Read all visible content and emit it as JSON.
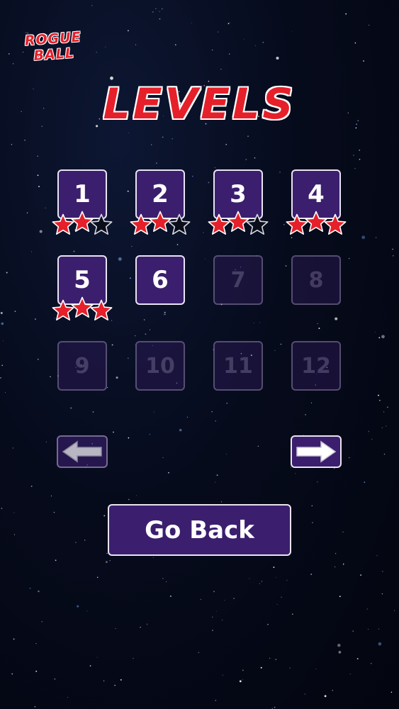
{
  "app": {
    "logo_line1": "ROGUE",
    "logo_line2": "BALL"
  },
  "screen": {
    "title": "LEVELS"
  },
  "levels": [
    {
      "label": "1",
      "unlocked": true,
      "stars": 2
    },
    {
      "label": "2",
      "unlocked": true,
      "stars": 2
    },
    {
      "label": "3",
      "unlocked": true,
      "stars": 2
    },
    {
      "label": "4",
      "unlocked": true,
      "stars": 3
    },
    {
      "label": "5",
      "unlocked": true,
      "stars": 3
    },
    {
      "label": "6",
      "unlocked": true,
      "stars": 0
    },
    {
      "label": "7",
      "unlocked": false,
      "stars": 0
    },
    {
      "label": "8",
      "unlocked": false,
      "stars": 0
    },
    {
      "label": "9",
      "unlocked": false,
      "stars": 0
    },
    {
      "label": "10",
      "unlocked": false,
      "stars": 0
    },
    {
      "label": "11",
      "unlocked": false,
      "stars": 0
    },
    {
      "label": "12",
      "unlocked": false,
      "stars": 0
    }
  ],
  "nav": {
    "prev_icon": "arrow-left-icon",
    "prev_enabled": false,
    "next_icon": "arrow-right-icon",
    "next_enabled": true
  },
  "go_back": {
    "label": "Go Back"
  },
  "colors": {
    "accent_red": "#e5202a",
    "tile_purple": "#3b1f6e",
    "border": "#e8e4f2"
  }
}
